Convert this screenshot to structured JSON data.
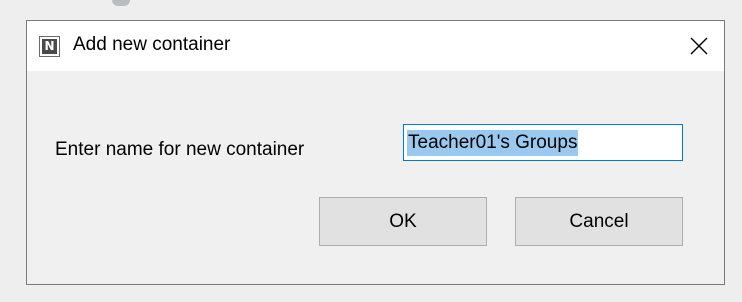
{
  "dialog": {
    "title": "Add new container",
    "app_icon_letter": "N",
    "close_icon": "close-icon"
  },
  "form": {
    "label": "Enter name for new container",
    "input_value": "Teacher01's Groups",
    "input_text_selected": true
  },
  "buttons": {
    "ok_label": "OK",
    "cancel_label": "Cancel"
  },
  "colors": {
    "selection_highlight": "#99c9ef",
    "input_focus_border": "#0078d7",
    "button_face": "#e1e1e1",
    "dialog_body": "#f0f0f0"
  }
}
